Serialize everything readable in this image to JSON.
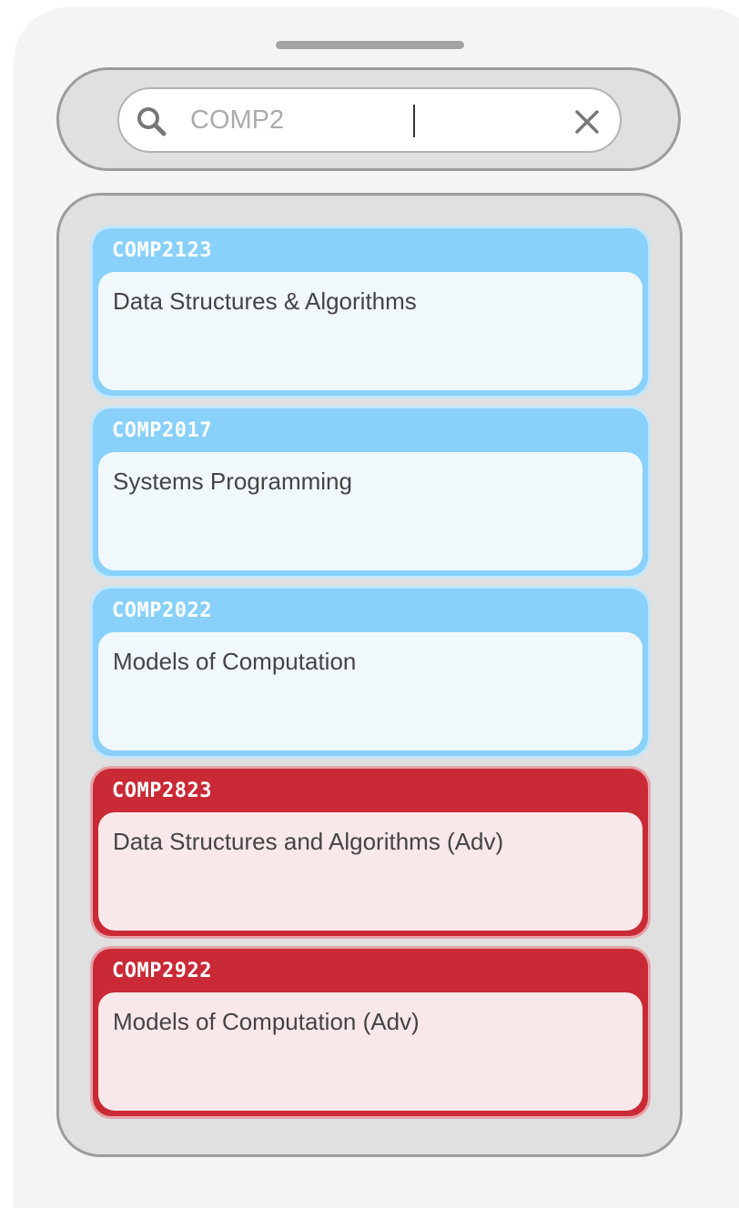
{
  "search": {
    "value": "COMP2",
    "icon": "search-icon",
    "clear_icon": "close-icon"
  },
  "results": [
    {
      "code": "COMP2123",
      "title": "Data Structures & Algorithms",
      "theme": "blue"
    },
    {
      "code": "COMP2017",
      "title": "Systems Programming",
      "theme": "blue"
    },
    {
      "code": "COMP2022",
      "title": "Models of Computation",
      "theme": "blue"
    },
    {
      "code": "COMP2823",
      "title": "Data Structures and Algorithms (Adv)",
      "theme": "red"
    },
    {
      "code": "COMP2922",
      "title": "Models of Computation (Adv)",
      "theme": "red"
    }
  ],
  "colors": {
    "blue_header": "#89d1fb",
    "blue_body": "#f1f8fc",
    "red_header": "#c92a36",
    "red_body": "#f9e8e9"
  }
}
